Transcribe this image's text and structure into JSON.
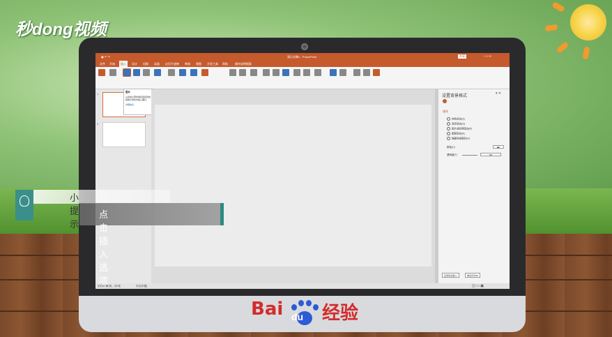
{
  "brand": {
    "logo_text": "秒dong视频"
  },
  "app": {
    "window_title": "演示文稿1 - PowerPoint",
    "menu": [
      "文件",
      "开始",
      "插入",
      "设计",
      "切换",
      "动画",
      "幻灯片放映",
      "审阅",
      "视图",
      "开发工具",
      "帮助",
      "操作说明搜索"
    ],
    "active_menu_index": 2,
    "share_label": "共享"
  },
  "tooltip": {
    "title": "图片",
    "body": "从您的计算机或您连接到的其他计算机中插入图片。",
    "more": "详细信息"
  },
  "thumbs": {
    "slide1": "1",
    "slide2": "2"
  },
  "panel": {
    "title": "设置背景格式",
    "section": "填充",
    "options": [
      "纯色填充(S)",
      "渐变填充(G)",
      "图片或纹理填充(P)",
      "图案填充(A)",
      "隐藏背景图形(H)"
    ],
    "color_label": "颜色(C)",
    "transparency_label": "透明度(T)",
    "transparency_value": "0%",
    "apply_all": "应用到全部(L)",
    "reset": "重置背景(B)"
  },
  "statusbar": {
    "slide_info": "幻灯片 第1张，共2张",
    "lang": "中文(中国)"
  },
  "tip": {
    "title": "小提示",
    "text": "点击插入选项"
  },
  "footer": {
    "baidu": "Bai",
    "du": "du",
    "jingyan": "经验"
  }
}
